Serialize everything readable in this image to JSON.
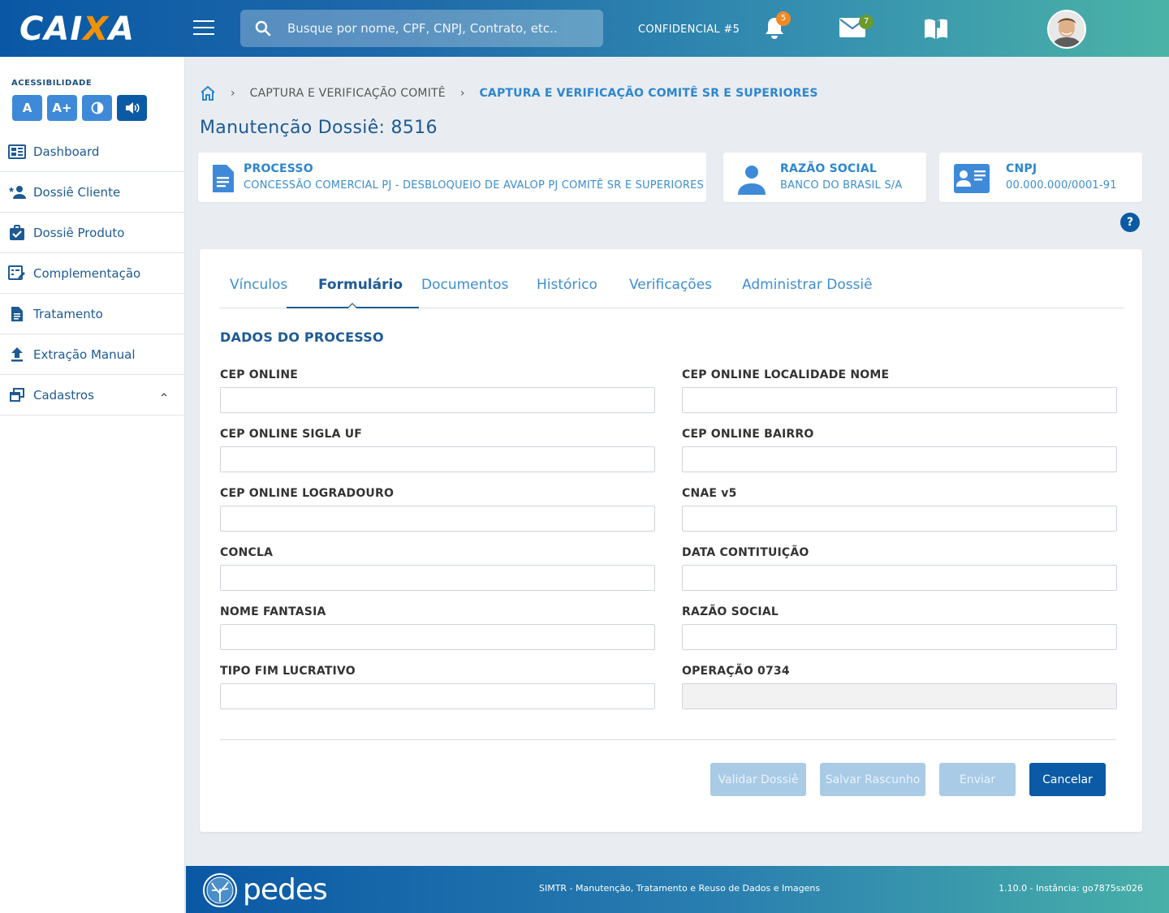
{
  "header": {
    "logo_text_a": "CAI",
    "logo_text_x": "X",
    "logo_text_b": "A",
    "search_placeholder": "Busque por nome, CPF, CNPJ, Contrato, etc..",
    "confidential_label": "CONFIDENCIAL #5",
    "notifications_count": "5",
    "messages_count": "7",
    "notification_badge_color": "#f08a24",
    "message_badge_color": "#6c9a2c"
  },
  "sidebar": {
    "accessibility_title": "ACESSIBILIDADE",
    "accessibility_buttons": [
      "A",
      "A+"
    ],
    "items": [
      {
        "label": "Dashboard",
        "icon": "dashboard-icon"
      },
      {
        "label": "Dossiê Cliente",
        "icon": "client-icon"
      },
      {
        "label": "Dossiê Produto",
        "icon": "product-icon"
      },
      {
        "label": "Complementação",
        "icon": "complement-icon"
      },
      {
        "label": "Tratamento",
        "icon": "document-icon"
      },
      {
        "label": "Extração Manual",
        "icon": "upload-icon"
      },
      {
        "label": "Cadastros",
        "icon": "windows-icon"
      }
    ]
  },
  "breadcrumb": {
    "items": [
      "CAPTURA E VERIFICAÇÃO COMITÊ",
      "CAPTURA E VERIFICAÇÃO COMITÊ SR E SUPERIORES"
    ],
    "separator": "›"
  },
  "page": {
    "title": "Manutenção Dossiê: 8516"
  },
  "cards": {
    "processo": {
      "label": "PROCESSO",
      "value": "CONCESSÃO COMERCIAL PJ - DESBLOQUEIO DE AVALOP PJ COMITÊ SR E SUPERIORES"
    },
    "razao": {
      "label": "RAZÃO SOCIAL",
      "value": "BANCO DO BRASIL S/A"
    },
    "cnpj": {
      "label": "CNPJ",
      "value": "00.000.000/0001-91"
    }
  },
  "help_label": "?",
  "tabs": [
    "Vínculos",
    "Formulário",
    "Documentos",
    "Histórico",
    "Verificações",
    "Administrar Dossiê"
  ],
  "active_tab": "Formulário",
  "form": {
    "section_title": "DADOS DO PROCESSO",
    "fields": [
      {
        "label": "CEP ONLINE",
        "value": ""
      },
      {
        "label": "CEP ONLINE LOCALIDADE NOME",
        "value": ""
      },
      {
        "label": "CEP ONLINE SIGLA UF",
        "value": ""
      },
      {
        "label": "CEP ONLINE BAIRRO",
        "value": ""
      },
      {
        "label": "CEP ONLINE LOGRADOURO",
        "value": ""
      },
      {
        "label": "CNAE v5",
        "value": ""
      },
      {
        "label": "CONCLA",
        "value": ""
      },
      {
        "label": "DATA CONTITUIÇÃO",
        "value": ""
      },
      {
        "label": "NOME FANTASIA",
        "value": ""
      },
      {
        "label": "RAZÃO SOCIAL",
        "value": ""
      },
      {
        "label": "TIPO FIM LUCRATIVO",
        "value": ""
      },
      {
        "label": "OPERAÇÃO 0734",
        "value": ""
      }
    ]
  },
  "actions": {
    "validate": "Validar Dossiê",
    "save_draft": "Salvar Rascunho",
    "send": "Enviar",
    "cancel": "Cancelar"
  },
  "footer": {
    "brand": "pedes",
    "system_name": "SIMTR - Manutenção, Tratamento e Reuso de Dados e Imagens",
    "version": "1.10.0 - Instância: go7875sx026"
  }
}
